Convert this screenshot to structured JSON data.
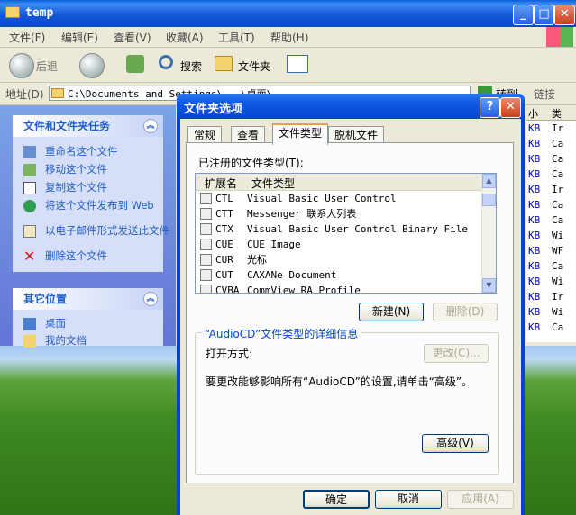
{
  "explorer": {
    "title": "temp",
    "menu": [
      "文件(F)",
      "编辑(E)",
      "查看(V)",
      "收藏(A)",
      "工具(T)",
      "帮助(H)"
    ],
    "toolbar": {
      "back": "后退",
      "search": "搜索",
      "folders": "文件夹"
    },
    "address_label": "地址(D)",
    "address_value": "C:\\Documents and Settings\\...\\桌面\\",
    "go_label": "转到",
    "links_label": "链接",
    "left_pane": {
      "tasks_title": "文件和文件夹任务",
      "tasks": [
        "重命名这个文件",
        "移动这个文件",
        "复制这个文件",
        "将这个文件发布到 Web",
        "以电子邮件形式发送此文件",
        "删除这个文件"
      ],
      "places_title": "其它位置",
      "places": [
        "桌面",
        "我的文档"
      ]
    },
    "right_list": {
      "headers": [
        "小",
        "类"
      ],
      "rows": [
        {
          "size": "KB",
          "type": "Ir"
        },
        {
          "size": "KB",
          "type": "Ca"
        },
        {
          "size": "KB",
          "type": "Ca"
        },
        {
          "size": "KB",
          "type": "Ca"
        },
        {
          "size": "KB",
          "type": "Ir"
        },
        {
          "size": "KB",
          "type": "Ca"
        },
        {
          "size": "KB",
          "type": "Ca"
        },
        {
          "size": "KB",
          "type": "Wi"
        },
        {
          "size": "KB",
          "type": "WF"
        },
        {
          "size": "KB",
          "type": "Ca"
        },
        {
          "size": "KB",
          "type": "Wi"
        },
        {
          "size": "KB",
          "type": "Ir"
        },
        {
          "size": "KB",
          "type": "Wi"
        },
        {
          "size": "KB",
          "type": "Ca"
        }
      ]
    }
  },
  "dialog": {
    "title": "文件夹选项",
    "tabs": [
      "常规",
      "查看",
      "文件类型",
      "脱机文件"
    ],
    "registered_label": "已注册的文件类型(T):",
    "columns": {
      "ext": "扩展名",
      "type": "文件类型"
    },
    "file_types": [
      {
        "ext": "CTL",
        "type": "Visual Basic User Control"
      },
      {
        "ext": "CTT",
        "type": "Messenger 联系人列表"
      },
      {
        "ext": "CTX",
        "type": "Visual Basic User Control Binary File"
      },
      {
        "ext": "CUE",
        "type": "CUE Image"
      },
      {
        "ext": "CUR",
        "type": "光标"
      },
      {
        "ext": "CUT",
        "type": "CAXANe Document"
      },
      {
        "ext": "CVBA",
        "type": "CommView RA Profile"
      }
    ],
    "new_button": "新建(N)",
    "delete_button": "删除(D)",
    "details_title": "“AudioCD”文件类型的详细信息",
    "opens_with_label": "打开方式:",
    "change_button": "更改(C)...",
    "advanced_text": "要更改能够影响所有“AudioCD”的设置,请单击“高级”。",
    "advanced_button": "高级(V)",
    "ok_button": "确定",
    "cancel_button": "取消",
    "apply_button": "应用(A)"
  }
}
